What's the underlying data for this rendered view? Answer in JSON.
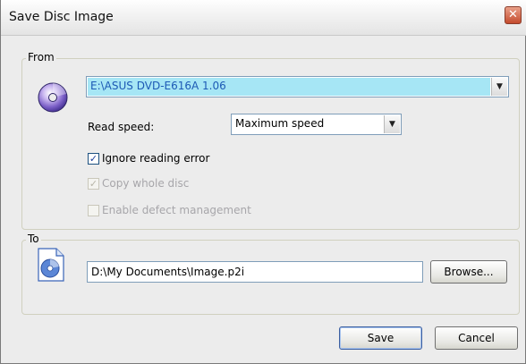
{
  "window": {
    "title": "Save Disc Image"
  },
  "from_group": {
    "legend": "From",
    "source_drive": {
      "value": "E:\\ASUS DVD-E616A 1.06"
    },
    "read_speed": {
      "label": "Read speed:",
      "value": "Maximum speed"
    },
    "ignore_reading_error": {
      "label": "Ignore reading error",
      "checked": true,
      "enabled": true
    },
    "copy_whole_disc": {
      "label": "Copy whole disc",
      "checked": true,
      "enabled": false
    },
    "enable_defect_management": {
      "label": "Enable defect management",
      "checked": false,
      "enabled": false
    }
  },
  "to_group": {
    "legend": "To",
    "destination_path": {
      "value": "D:\\My Documents\\Image.p2i"
    },
    "browse_label": "Browse..."
  },
  "buttons": {
    "save_label": "Save",
    "cancel_label": "Cancel"
  },
  "icons": {
    "close": "close-icon",
    "disc": "disc-icon",
    "file": "disc-image-file-icon"
  },
  "colors": {
    "selection_highlight": "#a6e6f5",
    "close_button": "#c44b2d",
    "group_border": "#d0d0bf"
  }
}
